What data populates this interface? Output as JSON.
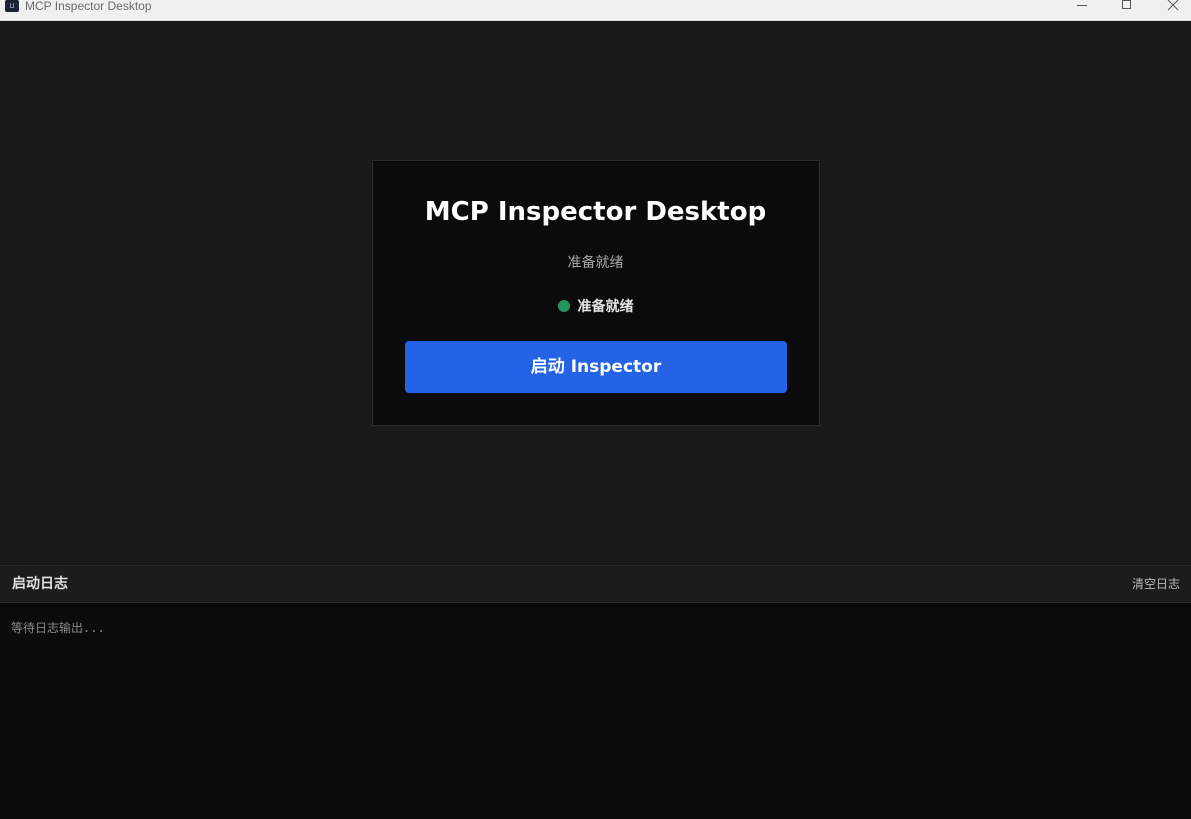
{
  "window": {
    "title": "MCP Inspector Desktop",
    "icon": "app-logo-icon",
    "controls": [
      "minimize-icon",
      "maximize-icon",
      "close-icon"
    ]
  },
  "main": {
    "title": "MCP Inspector Desktop",
    "subtitle": "准备就绪",
    "status": {
      "label": "准备就绪",
      "color": "#22955b"
    },
    "start_button_label": "启动 Inspector",
    "accent_color": "#2563e6"
  },
  "log": {
    "title": "启动日志",
    "clear_label": "清空日志",
    "placeholder": "等待日志输出..."
  }
}
